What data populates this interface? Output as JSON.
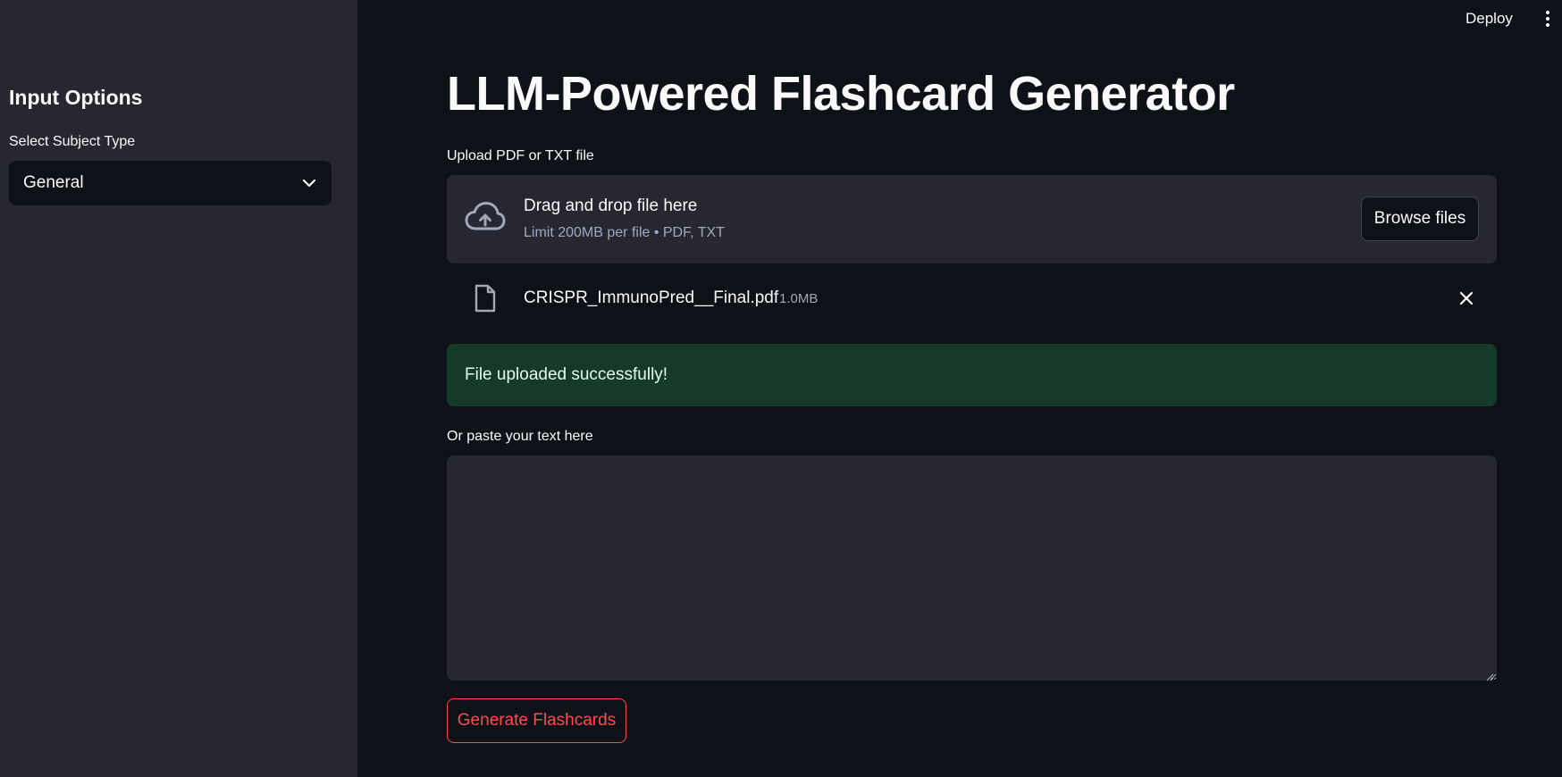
{
  "header": {
    "deploy_label": "Deploy",
    "menu_icon": "more-vertical-icon"
  },
  "sidebar": {
    "heading": "Input Options",
    "subject_select": {
      "label": "Select Subject Type",
      "value": "General",
      "icon": "chevron-down-icon"
    }
  },
  "main": {
    "title": "LLM-Powered Flashcard Generator",
    "uploader": {
      "label": "Upload PDF or TXT file",
      "drop_title": "Drag and drop file here",
      "drop_subtitle": "Limit 200MB per file • PDF, TXT",
      "browse_label": "Browse files",
      "icon": "cloud-upload-icon"
    },
    "uploaded_file": {
      "name": "CRISPR_ImmunoPred__Final.pdf",
      "size": "1.0MB",
      "icon": "file-icon",
      "remove_icon": "close-icon"
    },
    "success_message": "File uploaded successfully!",
    "paste": {
      "label": "Or paste your text here",
      "value": ""
    },
    "generate_label": "Generate Flashcards"
  },
  "colors": {
    "background": "#0e1117",
    "sidebar": "#262730",
    "success_bg": "#173928",
    "success_text": "#dffde9",
    "accent": "#ff4b4b"
  }
}
